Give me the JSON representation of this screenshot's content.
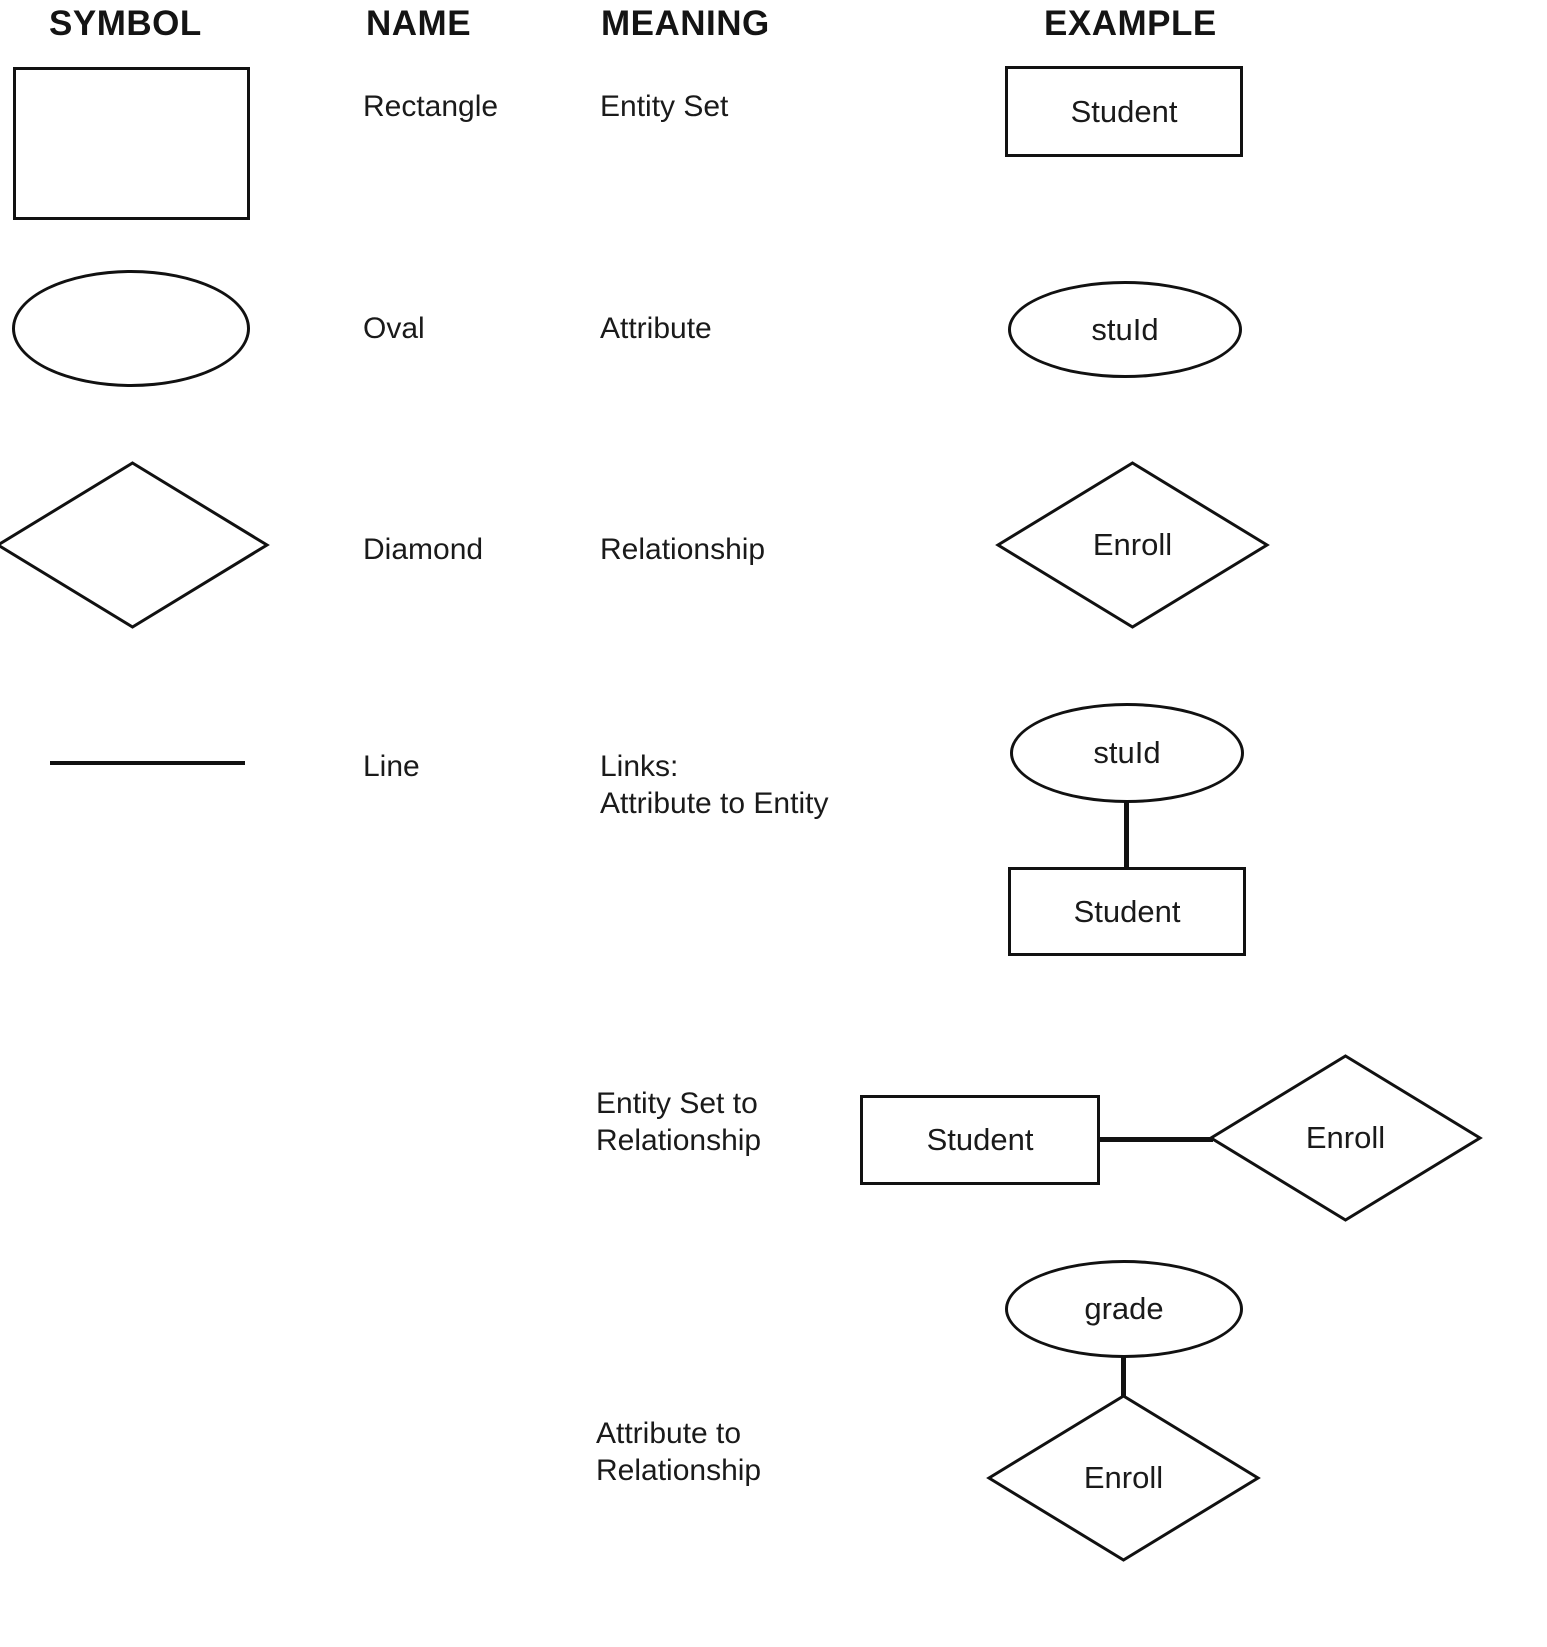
{
  "headers": {
    "symbol": "SYMBOL",
    "name": "NAME",
    "meaning": "MEANING",
    "example": "EXAMPLE"
  },
  "rows": [
    {
      "symbol": "rectangle-shape",
      "name": "Rectangle",
      "meaning": "Entity Set",
      "example_labels": [
        "Student"
      ]
    },
    {
      "symbol": "oval-shape",
      "name": "Oval",
      "meaning": "Attribute",
      "example_labels": [
        "stuId"
      ]
    },
    {
      "symbol": "diamond-shape",
      "name": "Diamond",
      "meaning": "Relationship",
      "example_labels": [
        "Enroll"
      ]
    },
    {
      "symbol": "line-shape",
      "name": "Line",
      "meaning": "Links:\nAttribute to Entity",
      "example_labels": [
        "stuId",
        "Student"
      ]
    },
    {
      "symbol": "",
      "name": "",
      "meaning": "Entity Set to\nRelationship",
      "example_labels": [
        "Student",
        "Enroll"
      ]
    },
    {
      "symbol": "",
      "name": "",
      "meaning": "Attribute to\nRelationship",
      "example_labels": [
        "grade",
        "Enroll"
      ]
    }
  ],
  "examples": {
    "entity_student": "Student",
    "attribute_stuid": "stuId",
    "relationship_enroll": "Enroll",
    "link_attr_entity": {
      "attribute": "stuId",
      "entity": "Student"
    },
    "link_entity_rel": {
      "entity": "Student",
      "relationship": "Enroll"
    },
    "link_attr_rel": {
      "attribute": "grade",
      "relationship": "Enroll"
    }
  },
  "colors": {
    "stroke": "#111111",
    "text": "#1a1a1a",
    "background": "#ffffff"
  }
}
